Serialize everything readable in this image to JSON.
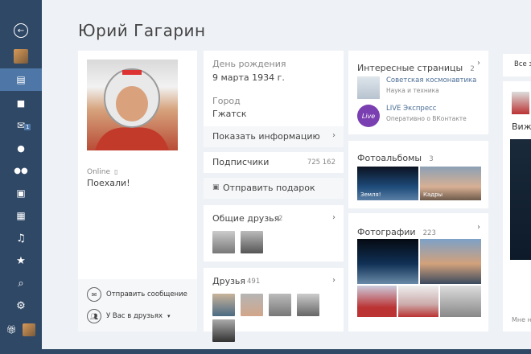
{
  "sidebar": {
    "items": [
      {
        "icon": "back-arrow-icon",
        "glyph": "←"
      },
      {
        "icon": "avatar-icon",
        "glyph": ""
      },
      {
        "icon": "news-icon",
        "glyph": "▤"
      },
      {
        "icon": "messages-icon",
        "glyph": "■"
      },
      {
        "icon": "mail-icon",
        "glyph": "✉",
        "badge": "1"
      },
      {
        "icon": "person-icon",
        "glyph": "👤"
      },
      {
        "icon": "friends-icon",
        "glyph": "👥"
      },
      {
        "icon": "photos-icon",
        "glyph": "▣"
      },
      {
        "icon": "video-icon",
        "glyph": "▦"
      },
      {
        "icon": "music-icon",
        "glyph": "♫"
      },
      {
        "icon": "favorites-star-icon",
        "glyph": "★"
      },
      {
        "icon": "search-icon",
        "glyph": "⌕"
      },
      {
        "icon": "settings-gear-icon",
        "glyph": "⚙"
      }
    ]
  },
  "profile": {
    "name": "Юрий Гагарин",
    "status_online": "Online",
    "status_text": "Поехали!",
    "send_message": "Отправить сообщение",
    "in_friends": "У Вас в друзьях"
  },
  "info": {
    "birthday_label": "День рождения",
    "birthday_value": "9 марта 1934 г.",
    "city_label": "Город",
    "city_value": "Гжатск",
    "show_info": "Показать информацию",
    "subscribers_label": "Подписчики",
    "subscribers_count": "725 162",
    "send_gift": "Отправить подарок",
    "mutual_friends_label": "Общие друзья",
    "mutual_friends_count": "2",
    "friends_label": "Друзья",
    "friends_count": "491"
  },
  "pages": {
    "label": "Интересные страницы",
    "count": "2",
    "items": [
      {
        "title": "Советская космонавтика",
        "subtitle": "Наука и техника"
      },
      {
        "title": "LIVE Экспресс",
        "subtitle": "Оперативно о ВКонтакте"
      }
    ],
    "live_badge": "Live"
  },
  "albums": {
    "label": "Фотоальбомы",
    "count": "3",
    "items": [
      {
        "caption": "Земля!"
      },
      {
        "caption": "Кадры"
      }
    ]
  },
  "photos": {
    "label": "Фотографии",
    "count": "223"
  },
  "right_panel": {
    "tab": "Все з",
    "heading": "Вижу",
    "footer": "Мне н"
  },
  "colors": {
    "sidebar": "#2f4866",
    "sidebar_active": "#4e77a8",
    "link": "#4a6d96",
    "background": "#eef1f5"
  }
}
